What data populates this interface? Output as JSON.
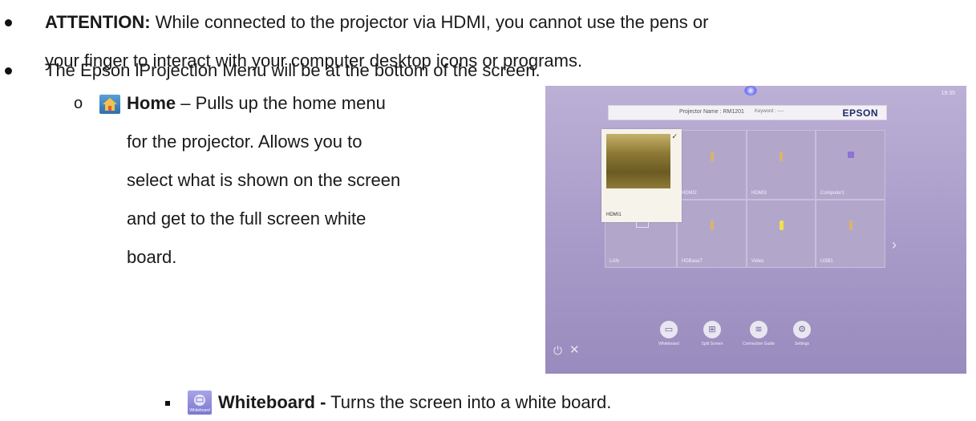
{
  "bullets": {
    "attention_label": "ATTENTION:",
    "attention_text": " While connected to the projector via HDMI, you cannot use the pens or",
    "attention_text2": "your finger to interact with your computer desktop icons or programs.",
    "menu_text": "The Epson iProjection Menu will be at the bottom of the screen."
  },
  "home": {
    "icon": "home-icon",
    "label": "Home",
    "line1": " – Pulls up the home menu",
    "line2": "for the projector. Allows you to",
    "line3": "select what is shown on the screen",
    "line4": "and get to the full screen white",
    "line5": "board."
  },
  "whiteboard": {
    "icon": "whiteboard-icon",
    "icon_caption": "Whiteboard",
    "label": "Whiteboard -",
    "text": " Turns the screen into a white board."
  },
  "photo": {
    "clock": "19:35",
    "projector_name": "Projector Name : RM1201",
    "keyword": "Keyword : ----",
    "brand": "EPSON",
    "sources": [
      {
        "label": "HDMI1"
      },
      {
        "label": "HDMI2"
      },
      {
        "label": "HDMI3"
      },
      {
        "label": "Computer1"
      },
      {
        "label": "LAN"
      },
      {
        "label": "HDBaseT"
      },
      {
        "label": "Video"
      },
      {
        "label": "USB1"
      }
    ],
    "buttons": [
      {
        "label": "Whiteboard",
        "icon": "whiteboard-icon"
      },
      {
        "label": "Split Screen",
        "icon": "split-screen-icon"
      },
      {
        "label": "Connection Guide",
        "icon": "wifi-icon"
      },
      {
        "label": "Settings",
        "icon": "gear-icon"
      }
    ]
  }
}
